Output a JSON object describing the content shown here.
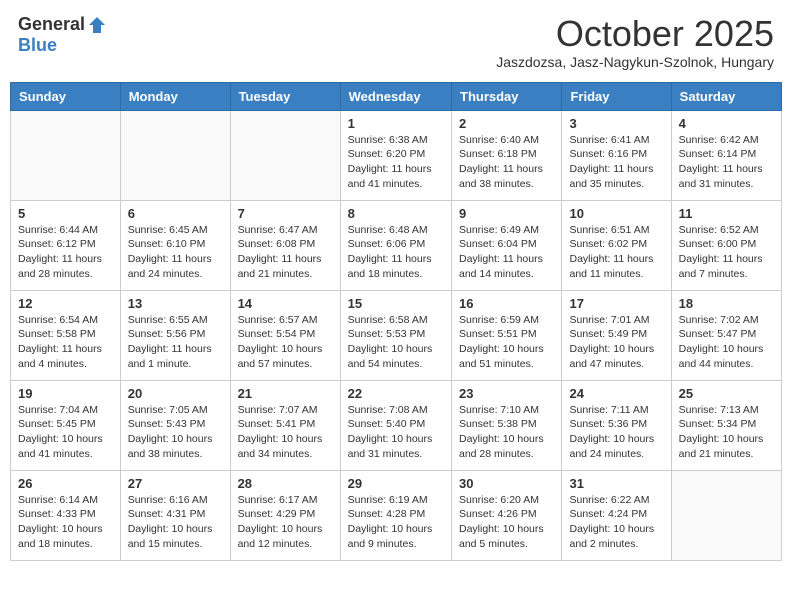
{
  "header": {
    "logo_general": "General",
    "logo_blue": "Blue",
    "month_title": "October 2025",
    "subtitle": "Jaszdozsa, Jasz-Nagykun-Szolnok, Hungary"
  },
  "days_of_week": [
    "Sunday",
    "Monday",
    "Tuesday",
    "Wednesday",
    "Thursday",
    "Friday",
    "Saturday"
  ],
  "weeks": [
    [
      {
        "day": "",
        "info": ""
      },
      {
        "day": "",
        "info": ""
      },
      {
        "day": "",
        "info": ""
      },
      {
        "day": "1",
        "info": "Sunrise: 6:38 AM\nSunset: 6:20 PM\nDaylight: 11 hours and 41 minutes."
      },
      {
        "day": "2",
        "info": "Sunrise: 6:40 AM\nSunset: 6:18 PM\nDaylight: 11 hours and 38 minutes."
      },
      {
        "day": "3",
        "info": "Sunrise: 6:41 AM\nSunset: 6:16 PM\nDaylight: 11 hours and 35 minutes."
      },
      {
        "day": "4",
        "info": "Sunrise: 6:42 AM\nSunset: 6:14 PM\nDaylight: 11 hours and 31 minutes."
      }
    ],
    [
      {
        "day": "5",
        "info": "Sunrise: 6:44 AM\nSunset: 6:12 PM\nDaylight: 11 hours and 28 minutes."
      },
      {
        "day": "6",
        "info": "Sunrise: 6:45 AM\nSunset: 6:10 PM\nDaylight: 11 hours and 24 minutes."
      },
      {
        "day": "7",
        "info": "Sunrise: 6:47 AM\nSunset: 6:08 PM\nDaylight: 11 hours and 21 minutes."
      },
      {
        "day": "8",
        "info": "Sunrise: 6:48 AM\nSunset: 6:06 PM\nDaylight: 11 hours and 18 minutes."
      },
      {
        "day": "9",
        "info": "Sunrise: 6:49 AM\nSunset: 6:04 PM\nDaylight: 11 hours and 14 minutes."
      },
      {
        "day": "10",
        "info": "Sunrise: 6:51 AM\nSunset: 6:02 PM\nDaylight: 11 hours and 11 minutes."
      },
      {
        "day": "11",
        "info": "Sunrise: 6:52 AM\nSunset: 6:00 PM\nDaylight: 11 hours and 7 minutes."
      }
    ],
    [
      {
        "day": "12",
        "info": "Sunrise: 6:54 AM\nSunset: 5:58 PM\nDaylight: 11 hours and 4 minutes."
      },
      {
        "day": "13",
        "info": "Sunrise: 6:55 AM\nSunset: 5:56 PM\nDaylight: 11 hours and 1 minute."
      },
      {
        "day": "14",
        "info": "Sunrise: 6:57 AM\nSunset: 5:54 PM\nDaylight: 10 hours and 57 minutes."
      },
      {
        "day": "15",
        "info": "Sunrise: 6:58 AM\nSunset: 5:53 PM\nDaylight: 10 hours and 54 minutes."
      },
      {
        "day": "16",
        "info": "Sunrise: 6:59 AM\nSunset: 5:51 PM\nDaylight: 10 hours and 51 minutes."
      },
      {
        "day": "17",
        "info": "Sunrise: 7:01 AM\nSunset: 5:49 PM\nDaylight: 10 hours and 47 minutes."
      },
      {
        "day": "18",
        "info": "Sunrise: 7:02 AM\nSunset: 5:47 PM\nDaylight: 10 hours and 44 minutes."
      }
    ],
    [
      {
        "day": "19",
        "info": "Sunrise: 7:04 AM\nSunset: 5:45 PM\nDaylight: 10 hours and 41 minutes."
      },
      {
        "day": "20",
        "info": "Sunrise: 7:05 AM\nSunset: 5:43 PM\nDaylight: 10 hours and 38 minutes."
      },
      {
        "day": "21",
        "info": "Sunrise: 7:07 AM\nSunset: 5:41 PM\nDaylight: 10 hours and 34 minutes."
      },
      {
        "day": "22",
        "info": "Sunrise: 7:08 AM\nSunset: 5:40 PM\nDaylight: 10 hours and 31 minutes."
      },
      {
        "day": "23",
        "info": "Sunrise: 7:10 AM\nSunset: 5:38 PM\nDaylight: 10 hours and 28 minutes."
      },
      {
        "day": "24",
        "info": "Sunrise: 7:11 AM\nSunset: 5:36 PM\nDaylight: 10 hours and 24 minutes."
      },
      {
        "day": "25",
        "info": "Sunrise: 7:13 AM\nSunset: 5:34 PM\nDaylight: 10 hours and 21 minutes."
      }
    ],
    [
      {
        "day": "26",
        "info": "Sunrise: 6:14 AM\nSunset: 4:33 PM\nDaylight: 10 hours and 18 minutes."
      },
      {
        "day": "27",
        "info": "Sunrise: 6:16 AM\nSunset: 4:31 PM\nDaylight: 10 hours and 15 minutes."
      },
      {
        "day": "28",
        "info": "Sunrise: 6:17 AM\nSunset: 4:29 PM\nDaylight: 10 hours and 12 minutes."
      },
      {
        "day": "29",
        "info": "Sunrise: 6:19 AM\nSunset: 4:28 PM\nDaylight: 10 hours and 9 minutes."
      },
      {
        "day": "30",
        "info": "Sunrise: 6:20 AM\nSunset: 4:26 PM\nDaylight: 10 hours and 5 minutes."
      },
      {
        "day": "31",
        "info": "Sunrise: 6:22 AM\nSunset: 4:24 PM\nDaylight: 10 hours and 2 minutes."
      },
      {
        "day": "",
        "info": ""
      }
    ]
  ]
}
